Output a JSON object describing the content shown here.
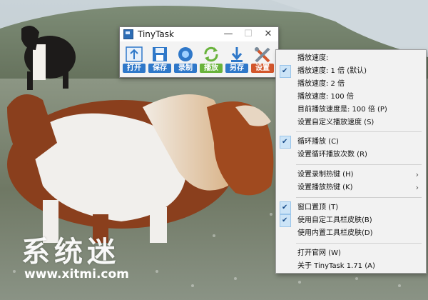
{
  "window": {
    "title": "TinyTask",
    "controls": {
      "minimize": "—",
      "maximize": "☐",
      "close": "✕"
    }
  },
  "toolbar": [
    {
      "label": "打开",
      "icon": "open-icon"
    },
    {
      "label": "保存",
      "icon": "save-icon"
    },
    {
      "label": "录制",
      "icon": "record-icon"
    },
    {
      "label": "播放",
      "icon": "play-icon"
    },
    {
      "label": "另存",
      "icon": "save-as-icon"
    },
    {
      "label": "设置",
      "icon": "settings-icon"
    }
  ],
  "menu": {
    "items": [
      {
        "label": "播放速度:",
        "checked": false
      },
      {
        "label": "播放速度:    1 倍 (默认)",
        "checked": true
      },
      {
        "label": "播放速度:    2 倍",
        "checked": false
      },
      {
        "label": "播放速度:    100 倍",
        "checked": false
      },
      {
        "label": "目前播放速度是: 100 倍 (P)",
        "checked": false
      },
      {
        "label": "设置自定义播放速度 (S)",
        "checked": false
      },
      {
        "label": "循环播放 (C)",
        "checked": true
      },
      {
        "label": "设置循环播放次数 (R)",
        "checked": false
      },
      {
        "label": "设置录制热键 (H)",
        "checked": false,
        "submenu": true
      },
      {
        "label": "设置播放热键 (K)",
        "checked": false,
        "submenu": true
      },
      {
        "label": "窗口置顶 (T)",
        "checked": true
      },
      {
        "label": "使用自定工具栏皮肤(B)",
        "checked": true
      },
      {
        "label": "使用内置工具栏皮肤(D)",
        "checked": false
      },
      {
        "label": "打开官网 (W)",
        "checked": false
      },
      {
        "label": "关于 TinyTask 1.71 (A)",
        "checked": false
      }
    ]
  },
  "watermark": {
    "text": "系统迷",
    "url": "www.xitmi.com"
  }
}
